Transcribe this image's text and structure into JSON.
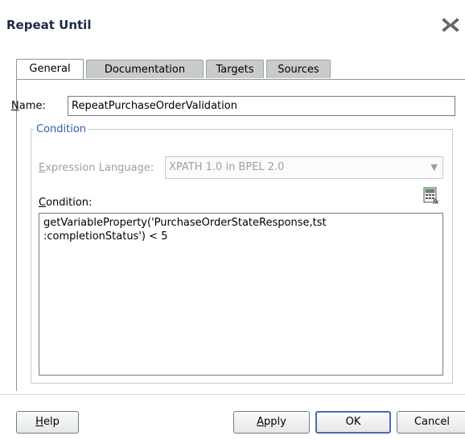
{
  "dialog": {
    "title": "Repeat Until",
    "tabs": [
      {
        "label": "General",
        "active": true
      },
      {
        "label": "Documentation",
        "active": false
      },
      {
        "label": "Targets",
        "active": false
      },
      {
        "label": "Sources",
        "active": false
      }
    ],
    "name": {
      "label_mnemonic": "N",
      "label_rest": "ame:",
      "value": "RepeatPurchaseOrderValidation"
    },
    "condition_group": {
      "legend": "Condition",
      "expression_language": {
        "label_mnemonic": "E",
        "label_rest": "xpression Language:",
        "value": "XPATH 1.0 in BPEL 2.0",
        "enabled": false
      },
      "condition": {
        "label_mnemonic": "C",
        "label_rest": "ondition:",
        "text": "getVariableProperty('PurchaseOrderStateResponse,tst\n:completionStatus') < 5"
      },
      "calculator_icon": "expression-builder-icon"
    },
    "buttons": {
      "help": {
        "mnemonic": "H",
        "rest": "elp"
      },
      "apply": {
        "mnemonic": "A",
        "rest": "pply"
      },
      "ok": "OK",
      "cancel": "Cancel"
    },
    "close_icon": "close-icon"
  }
}
